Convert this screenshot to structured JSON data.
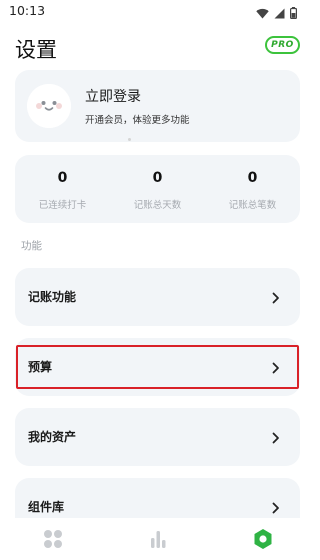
{
  "status_bar": {
    "time": "10:13",
    "icons": [
      "wifi-icon",
      "signal-icon",
      "battery-icon"
    ]
  },
  "header": {
    "title": "设置",
    "pro_badge": "PRO"
  },
  "profile": {
    "title": "立即登录",
    "subtitle": "开通会员，体验更多功能"
  },
  "stats": [
    {
      "value": "0",
      "label": "已连续打卡"
    },
    {
      "value": "0",
      "label": "记账总天数"
    },
    {
      "value": "0",
      "label": "记账总笔数"
    }
  ],
  "section": {
    "label": "功能"
  },
  "menu": [
    {
      "label": "记账功能",
      "highlighted": false
    },
    {
      "label": "预算",
      "highlighted": true
    },
    {
      "label": "我的资产",
      "highlighted": false
    },
    {
      "label": "组件库",
      "highlighted": false
    }
  ],
  "bottom_nav": {
    "tabs": [
      {
        "icon": "grid-icon",
        "active": false
      },
      {
        "icon": "bar-chart-icon",
        "active": false
      },
      {
        "icon": "settings-hexagon-icon",
        "active": true
      }
    ]
  },
  "colors": {
    "accent": "#3cc33c",
    "card_bg": "#f2f5f8",
    "highlight": "#d92128",
    "muted_text": "#a6aab0"
  }
}
